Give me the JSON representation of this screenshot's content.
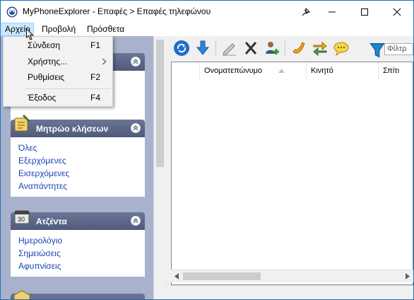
{
  "window": {
    "title": "MyPhoneExplorer -  Επαφές > Επαφές τηλεφώνου"
  },
  "menubar": {
    "items": [
      {
        "label": "Αρχείο"
      },
      {
        "label": "Προβολή"
      },
      {
        "label": "Πρόσθετα"
      }
    ]
  },
  "file_menu": {
    "items": [
      {
        "label": "Σύνδεση",
        "shortcut": "F1"
      },
      {
        "label": "Χρήστης...",
        "shortcut": ""
      },
      {
        "label": "Ρυθμίσεις",
        "shortcut": "F2"
      },
      {
        "label": "Έξοδος",
        "shortcut": "F4"
      }
    ]
  },
  "sidebar": {
    "call_log": {
      "title": "Μητρώο κλήσεων",
      "links": [
        "Όλες",
        "Εξερχόμενες",
        "Εισερχόμενες",
        "Αναπάντητες"
      ]
    },
    "organizer": {
      "title": "Ατζέντα",
      "links": [
        "Ημερολόγιο",
        "Σημειώσεις",
        "Αφυπνίσεις"
      ]
    }
  },
  "toolbar": {
    "filter_placeholder": "Φίλτρ"
  },
  "grid": {
    "columns": [
      "Ονοματεπώνυμο",
      "Κινητό",
      "Σπίτι"
    ]
  },
  "colors": {
    "accent": "#1e6fb8",
    "link": "#1a44b4",
    "sidebar_bg": "#a8b2cc",
    "panel_header": "#5a6486"
  }
}
